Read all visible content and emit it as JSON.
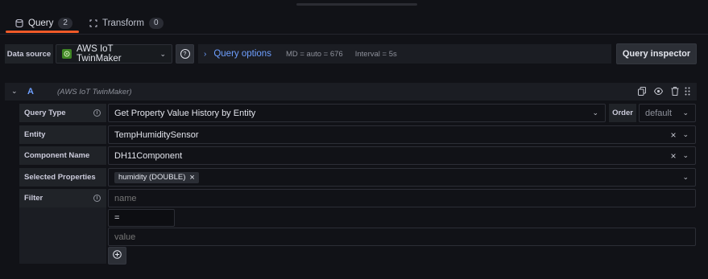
{
  "tabs": [
    {
      "label": "Query",
      "count": "2",
      "icon": "database-icon"
    },
    {
      "label": "Transform",
      "count": "0",
      "icon": "transform-icon"
    }
  ],
  "toolbar": {
    "datasource_label": "Data source",
    "datasource_value": "AWS IoT TwinMaker",
    "query_options_label": "Query options",
    "md_text": "MD = auto = 676",
    "interval_text": "Interval = 5s",
    "query_inspector_label": "Query inspector"
  },
  "query": {
    "ref_id": "A",
    "datasource_name": "(AWS IoT TwinMaker)",
    "fields": {
      "query_type": {
        "label": "Query Type",
        "value": "Get Property Value History by Entity"
      },
      "order": {
        "label": "Order",
        "value": "default"
      },
      "entity": {
        "label": "Entity",
        "value": "TempHumiditySensor"
      },
      "component": {
        "label": "Component Name",
        "value": "DH11Component"
      },
      "properties": {
        "label": "Selected Properties",
        "chip": "humidity (DOUBLE)"
      },
      "filter": {
        "label": "Filter",
        "name_placeholder": "name",
        "operator": "=",
        "value_placeholder": "value"
      }
    }
  },
  "colors": {
    "accent": "#f05a28",
    "link": "#6e9fff",
    "background": "#111217"
  }
}
